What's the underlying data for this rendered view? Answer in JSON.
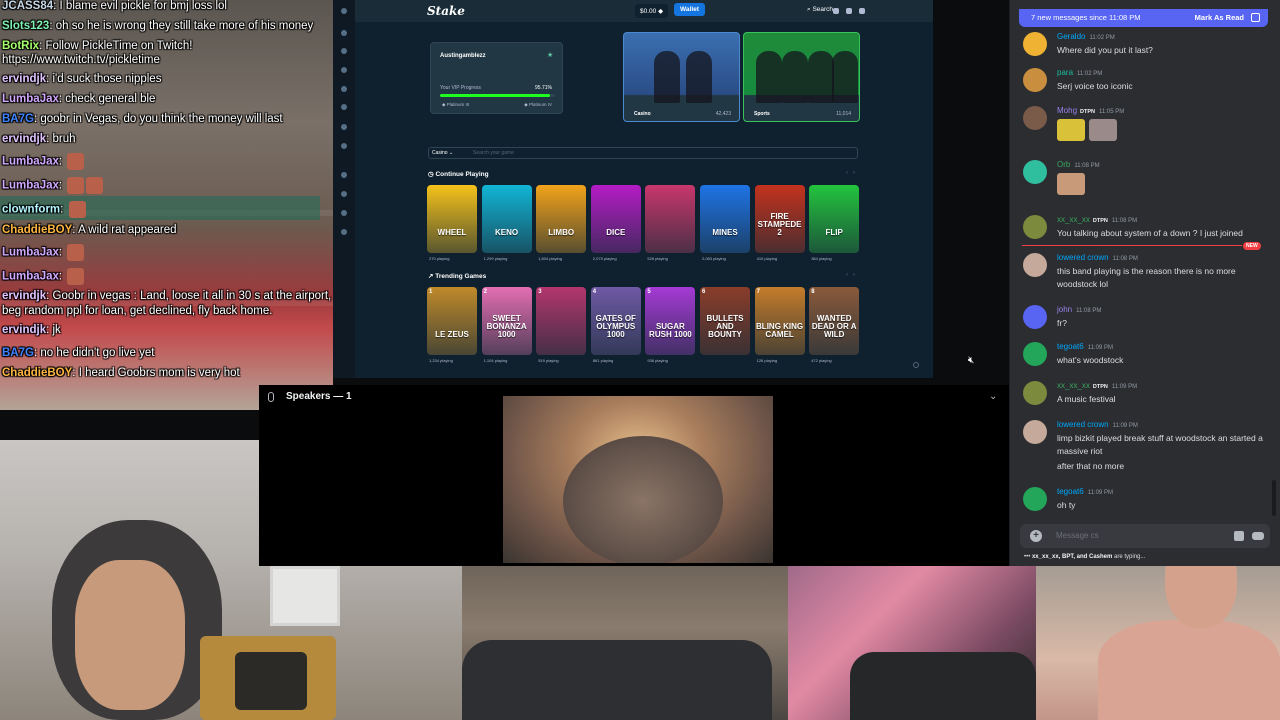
{
  "twitch_chat": [
    {
      "user": "JCASS84",
      "color": "#c6d7e6",
      "text": "I blame evil pickle for bmj loss lol"
    },
    {
      "user": "Slots123",
      "color": "#7ef0b0",
      "text": "oh so he is wrong they still take more of his money"
    },
    {
      "user": "BotRix",
      "color": "#a6ff6b",
      "text": "Follow PickleTime on Twitch!"
    },
    {
      "user": "",
      "color": "#ffffff",
      "text": "https://www.twitch.tv/pickletime"
    },
    {
      "user": "ervindjk",
      "color": "#e2c3ff",
      "text": "i'd suck those nipples"
    },
    {
      "user": "LumbaJax",
      "color": "#d3a8ff",
      "text": "check general ble"
    },
    {
      "user": "BA7G",
      "color": "#3f84ff",
      "text": "goobr in Vegas, do you think the money will last"
    },
    {
      "user": "ervindjk",
      "color": "#e2c3ff",
      "text": "bruh"
    },
    {
      "user": "LumbaJax",
      "color": "#d3a8ff",
      "text": ""
    },
    {
      "user": "LumbaJax",
      "color": "#d3a8ff",
      "text": ""
    },
    {
      "user": "clownform",
      "color": "#b3f7ff",
      "text": ""
    },
    {
      "user": "ChaddieBOY",
      "color": "#ffb640",
      "text": "A wild rat appeared"
    },
    {
      "user": "LumbaJax",
      "color": "#d3a8ff",
      "text": ""
    },
    {
      "user": "LumbaJax",
      "color": "#d3a8ff",
      "text": ""
    },
    {
      "user": "ervindjk",
      "color": "#e2c3ff",
      "text": "Goobr in vegas : Land, loose it all in 30 s at the airport,"
    },
    {
      "user": "",
      "color": "#ffffff",
      "text": "beg random ppl for loan, get declined, fly back home."
    },
    {
      "user": "ervindjk",
      "color": "#e2c3ff",
      "text": "jk"
    },
    {
      "user": "BA7G",
      "color": "#3f84ff",
      "text": "no he didn't go live yet"
    },
    {
      "user": "ChaddieBOY",
      "color": "#ffb640",
      "text": "I heard Goobrs mom is very hot"
    }
  ],
  "stake": {
    "logo": "Stake",
    "balance": "$0.00 ◆",
    "wallet_label": "Wallet",
    "search_label": "Search",
    "vip": {
      "username": "Austingamblezz",
      "progress_label": "Your VIP Progress",
      "progress_value": "95.71%",
      "progress_fraction": 0.9571,
      "rank_from": "Platinum III",
      "rank_to": "Platinum IV"
    },
    "banners": [
      {
        "label": "Casino",
        "count": "42,423",
        "color": "#3b6fb0"
      },
      {
        "label": "Sports",
        "count": "11,014",
        "color": "#1f8b3a"
      }
    ],
    "search": {
      "category": "Casino",
      "placeholder": "Search your game"
    },
    "continue_title": "Continue Playing",
    "trending_title": "Trending Games",
    "continue_games": [
      {
        "name": "WHEEL",
        "playing": "270 playing",
        "color": "#f6c21a"
      },
      {
        "name": "KENO",
        "playing": "1,299 playing",
        "color": "#11b5d6"
      },
      {
        "name": "LIMBO",
        "playing": "1,804 playing",
        "color": "#f3a31a"
      },
      {
        "name": "DICE",
        "playing": "2,075 playing",
        "color": "#b51cc6"
      },
      {
        "name": "",
        "playing": "526 playing",
        "color": "#c8376c"
      },
      {
        "name": "MINES",
        "playing": "2,083 playing",
        "color": "#1f74e6"
      },
      {
        "name": "FIRE STAMPEDE 2",
        "playing": "410 playing",
        "color": "#c4321d"
      },
      {
        "name": "FLIP",
        "playing": "384 playing",
        "color": "#23c43e"
      }
    ],
    "trending_games": [
      {
        "rank": "1",
        "name": "LE ZEUS",
        "playing": "1,234 playing",
        "color": "#c08a2a"
      },
      {
        "rank": "2",
        "name": "SWEET BONANZA 1000",
        "playing": "1,104 playing",
        "color": "#e46eb2"
      },
      {
        "rank": "3",
        "name": "",
        "playing": "519 playing",
        "color": "#b2366d"
      },
      {
        "rank": "4",
        "name": "GATES OF OLYMPUS 1000",
        "playing": "861 playing",
        "color": "#6f5aa6"
      },
      {
        "rank": "5",
        "name": "SUGAR RUSH 1000",
        "playing": "936 playing",
        "color": "#a53ad6"
      },
      {
        "rank": "6",
        "name": "BULLETS AND BOUNTY",
        "playing": "",
        "color": "#8a3d2a"
      },
      {
        "rank": "7",
        "name": "BLING KING CAMEL",
        "playing": "126 playing",
        "color": "#c57c2a"
      },
      {
        "rank": "8",
        "name": "WANTED DEAD OR A WILD",
        "playing": "472 playing",
        "color": "#8a5a3a"
      }
    ]
  },
  "stage": {
    "speakers_label": "Speakers — 1"
  },
  "discord": {
    "new_messages": "7 new messages since 11:08 PM",
    "mark_as_read": "Mark As Read",
    "new_badge": "NEW",
    "messages": [
      {
        "name": "Geraldo",
        "name_color": "#00a8fc",
        "time": "11:02 PM",
        "badge": "",
        "text": "Where did you put it last?",
        "avatar_color": "#f0b232"
      },
      {
        "name": "para",
        "name_color": "#1abc9c",
        "time": "11:02 PM",
        "badge": "",
        "text": "Serj voice too iconic",
        "avatar_color": "#c98f3e"
      },
      {
        "name": "Mohg",
        "name_color": "#9b84ec",
        "time": "11:05 PM",
        "badge": "DTPN",
        "text": "",
        "avatar_color": "#7a5a48"
      },
      {
        "name": "Orb",
        "name_color": "#3ba55d",
        "time": "11:08 PM",
        "badge": "",
        "text": "",
        "avatar_color": "#2fbf9f"
      },
      {
        "name": "xx_xx_xx",
        "name_color": "#3ba55d",
        "time": "11:08 PM",
        "badge": "DTPN",
        "text": "You talking about system of a down ? I just joined",
        "avatar_color": "#7b8a3c"
      },
      {
        "name": "lowered crown",
        "name_color": "#00a8fc",
        "time": "11:08 PM",
        "badge": "",
        "text": "this band playing is the reason there is no more woodstock lol",
        "avatar_color": "#c5a99a"
      },
      {
        "name": "john",
        "name_color": "#9b84ec",
        "time": "11:08 PM",
        "badge": "",
        "text": "fr?",
        "avatar_color": "#5865f2"
      },
      {
        "name": "tegoat6",
        "name_color": "#00a8fc",
        "time": "11:09 PM",
        "badge": "",
        "text": "what's woodstock",
        "avatar_color": "#23a55a"
      },
      {
        "name": "xx_xx_xx",
        "name_color": "#3ba55d",
        "time": "11:09 PM",
        "badge": "DTPN",
        "text": "A music festival",
        "avatar_color": "#7b8a3c"
      },
      {
        "name": "lowered crown",
        "name_color": "#00a8fc",
        "time": "11:09 PM",
        "badge": "",
        "text": "limp bizkit played break stuff at woodstock an started a massive riot",
        "text2": "after that no more",
        "avatar_color": "#c5a99a"
      },
      {
        "name": "tegoat6",
        "name_color": "#00a8fc",
        "time": "11:09 PM",
        "badge": "",
        "text": "oh ty",
        "avatar_color": "#23a55a"
      }
    ],
    "input_placeholder": "Message cs",
    "typing_names": "xx_xx_xx, BPT, and Cashem",
    "typing_suffix": "are typing..."
  }
}
